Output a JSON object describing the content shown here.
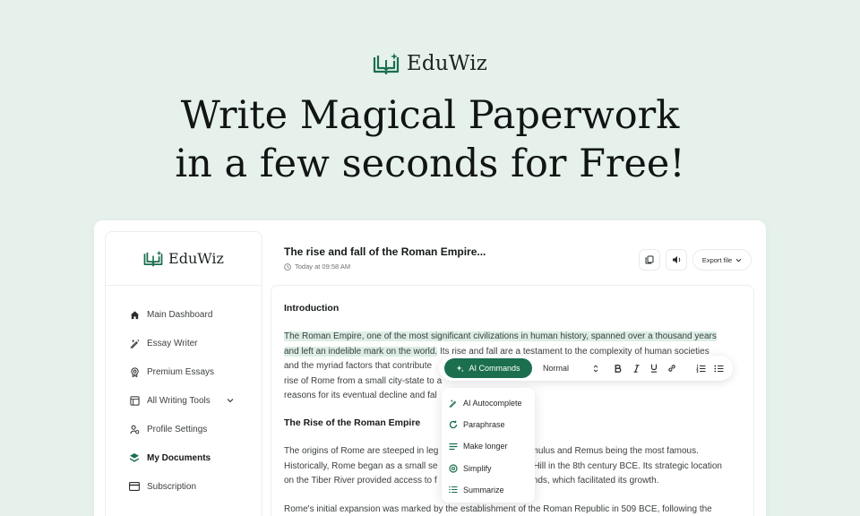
{
  "brand": {
    "name": "EduWiz"
  },
  "hero": {
    "line1": "Write Magical Paperwork",
    "line2": "in a few seconds for Free!"
  },
  "sidebar": {
    "items": [
      {
        "label": "Main Dashboard",
        "icon": "home-icon"
      },
      {
        "label": "Essay Writer",
        "icon": "pen-sparkle-icon"
      },
      {
        "label": "Premium Essays",
        "icon": "award-icon"
      },
      {
        "label": "All Writing Tools",
        "icon": "tools-icon"
      },
      {
        "label": "Profile Settings",
        "icon": "user-gear-icon"
      },
      {
        "label": "My Documents",
        "icon": "layers-icon",
        "active": true
      },
      {
        "label": "Subscription",
        "icon": "card-icon"
      }
    ]
  },
  "document": {
    "title": "The rise and fall of the Roman Empire...",
    "timestamp": "Today at 09:58 AM",
    "export_label": "Export file"
  },
  "editor": {
    "heading1": "Introduction",
    "p1_line1": "The Roman Empire, one of the most significant civilizations in human history, spanned over a thousand years",
    "p1_line2_hl": "and left an indelible mark on the world.",
    "p1_line2_rest": " Its rise and fall are a testament to the complexity of human societies",
    "p1_line3": "and the myriad factors that contribute",
    "p1_line4": "rise of Rome from a small city-state to a",
    "p1_line5": "reasons for its eventual decline and fal",
    "heading2": "The Rise of the Roman Empire",
    "p2_line1a": "The origins of Rome are steeped in leg",
    "p2_line1b": "omulus and Remus being the most famous.",
    "p2_line2a": "Historically, Rome began as a small se",
    "p2_line2b": "e Hill in the 8th century BCE. Its strategic location",
    "p2_line3a": "on the Tiber River provided access to f",
    "p2_line3b": "lands, which facilitated its growth.",
    "p3_line1": "Rome's initial expansion was marked by the establishment of the Roman Republic in 509 BCE, following the"
  },
  "toolbar": {
    "ai_label": "AI Commands",
    "style_value": "Normal"
  },
  "ai_menu": {
    "items": [
      {
        "label": "AI Autocomplete",
        "icon": "pen-sparkle-icon"
      },
      {
        "label": "Paraphrase",
        "icon": "refresh-icon"
      },
      {
        "label": "Make longer",
        "icon": "lines-icon"
      },
      {
        "label": "Simplify",
        "icon": "target-icon"
      },
      {
        "label": "Summarize",
        "icon": "list-icon"
      }
    ]
  },
  "colors": {
    "accent": "#1b6f4e",
    "background": "#e6f1ec",
    "highlight": "#dceee6"
  }
}
